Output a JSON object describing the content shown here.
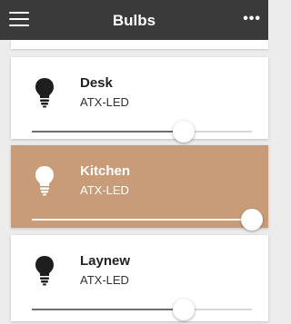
{
  "header": {
    "title": "Bulbs",
    "menu_icon": "hamburger-menu-icon",
    "more_icon": "more-icon",
    "more_text": "•••"
  },
  "colors": {
    "header_bg": "#3a3a3a",
    "active_card_bg": "#c99c79",
    "card_bg": "#ffffff"
  },
  "bulbs": [
    {
      "name": "Desk",
      "model": "ATX-LED",
      "brightness": 0.69,
      "active": false
    },
    {
      "name": "Kitchen",
      "model": "ATX-LED",
      "brightness": 1.0,
      "active": true
    },
    {
      "name": "Laynew",
      "model": "ATX-LED",
      "brightness": 0.69,
      "active": false
    }
  ]
}
